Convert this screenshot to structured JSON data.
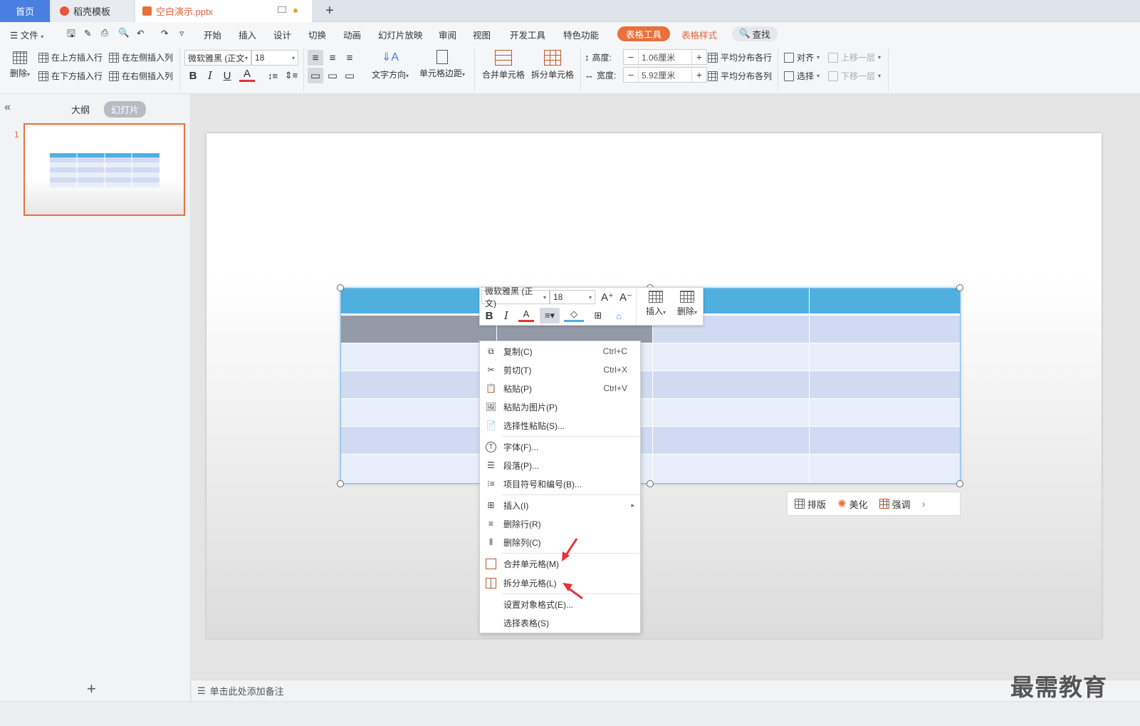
{
  "tabs": {
    "home": "首页",
    "template": "稻壳模板",
    "document": "空白演示.pptx"
  },
  "menu": {
    "file": "文件",
    "items": [
      "开始",
      "插入",
      "设计",
      "切换",
      "动画",
      "幻灯片放映",
      "审阅",
      "视图",
      "开发工具",
      "特色功能"
    ],
    "active": "表格工具",
    "table_style": "表格样式",
    "search": "查找"
  },
  "ribbon": {
    "delete": "删除",
    "insert_above": "在上方插入行",
    "insert_below": "在下方插入行",
    "insert_left": "在左侧插入列",
    "insert_right": "在右侧插入列",
    "font_name": "微软雅黑 (正文",
    "font_size": "18",
    "text_direction": "文字方向",
    "cell_margin": "单元格边距",
    "merge_cells": "合并单元格",
    "split_cells": "拆分单元格",
    "height_label": "高度:",
    "height_value": "1.06厘米",
    "width_label": "宽度:",
    "width_value": "5.92厘米",
    "distribute_rows": "平均分布各行",
    "distribute_cols": "平均分布各列",
    "align": "对齐",
    "select": "选择",
    "bring_forward": "上移一层",
    "send_backward": "下移一层"
  },
  "left_pane": {
    "outline": "大纲",
    "slides": "幻灯片",
    "slide_number": "1"
  },
  "minibar": {
    "font_name": "微软雅黑 (正文)",
    "font_size": "18",
    "insert": "插入",
    "delete": "删除"
  },
  "context_menu": {
    "copy": {
      "label": "复制(C)",
      "shortcut": "Ctrl+C"
    },
    "cut": {
      "label": "剪切(T)",
      "shortcut": "Ctrl+X"
    },
    "paste": {
      "label": "粘贴(P)",
      "shortcut": "Ctrl+V"
    },
    "paste_as_image": {
      "label": "粘贴为图片(P)"
    },
    "paste_special": {
      "label": "选择性粘贴(S)..."
    },
    "font": {
      "label": "字体(F)..."
    },
    "paragraph": {
      "label": "段落(P)..."
    },
    "bullets": {
      "label": "项目符号和编号(B)..."
    },
    "insert": {
      "label": "插入(I)"
    },
    "delete_row": {
      "label": "删除行(R)"
    },
    "delete_col": {
      "label": "删除列(C)"
    },
    "merge_cells": {
      "label": "合并单元格(M)"
    },
    "split_cells": {
      "label": "拆分单元格(L)"
    },
    "format_object": {
      "label": "设置对象格式(E)..."
    },
    "select_table": {
      "label": "选择表格(S)"
    }
  },
  "quickbar": {
    "layout": "排版",
    "beautify": "美化",
    "emphasize": "强调"
  },
  "notes": {
    "placeholder": "单击此处添加备注"
  },
  "watermark": "最需教育",
  "colors": {
    "accent": "#e8703a",
    "header_blue": "#4fb0e0",
    "row_dark": "#d0dbf2",
    "row_light": "#e8eef9",
    "selected_row": "#959aa8",
    "arrow_red": "#e8333a"
  }
}
